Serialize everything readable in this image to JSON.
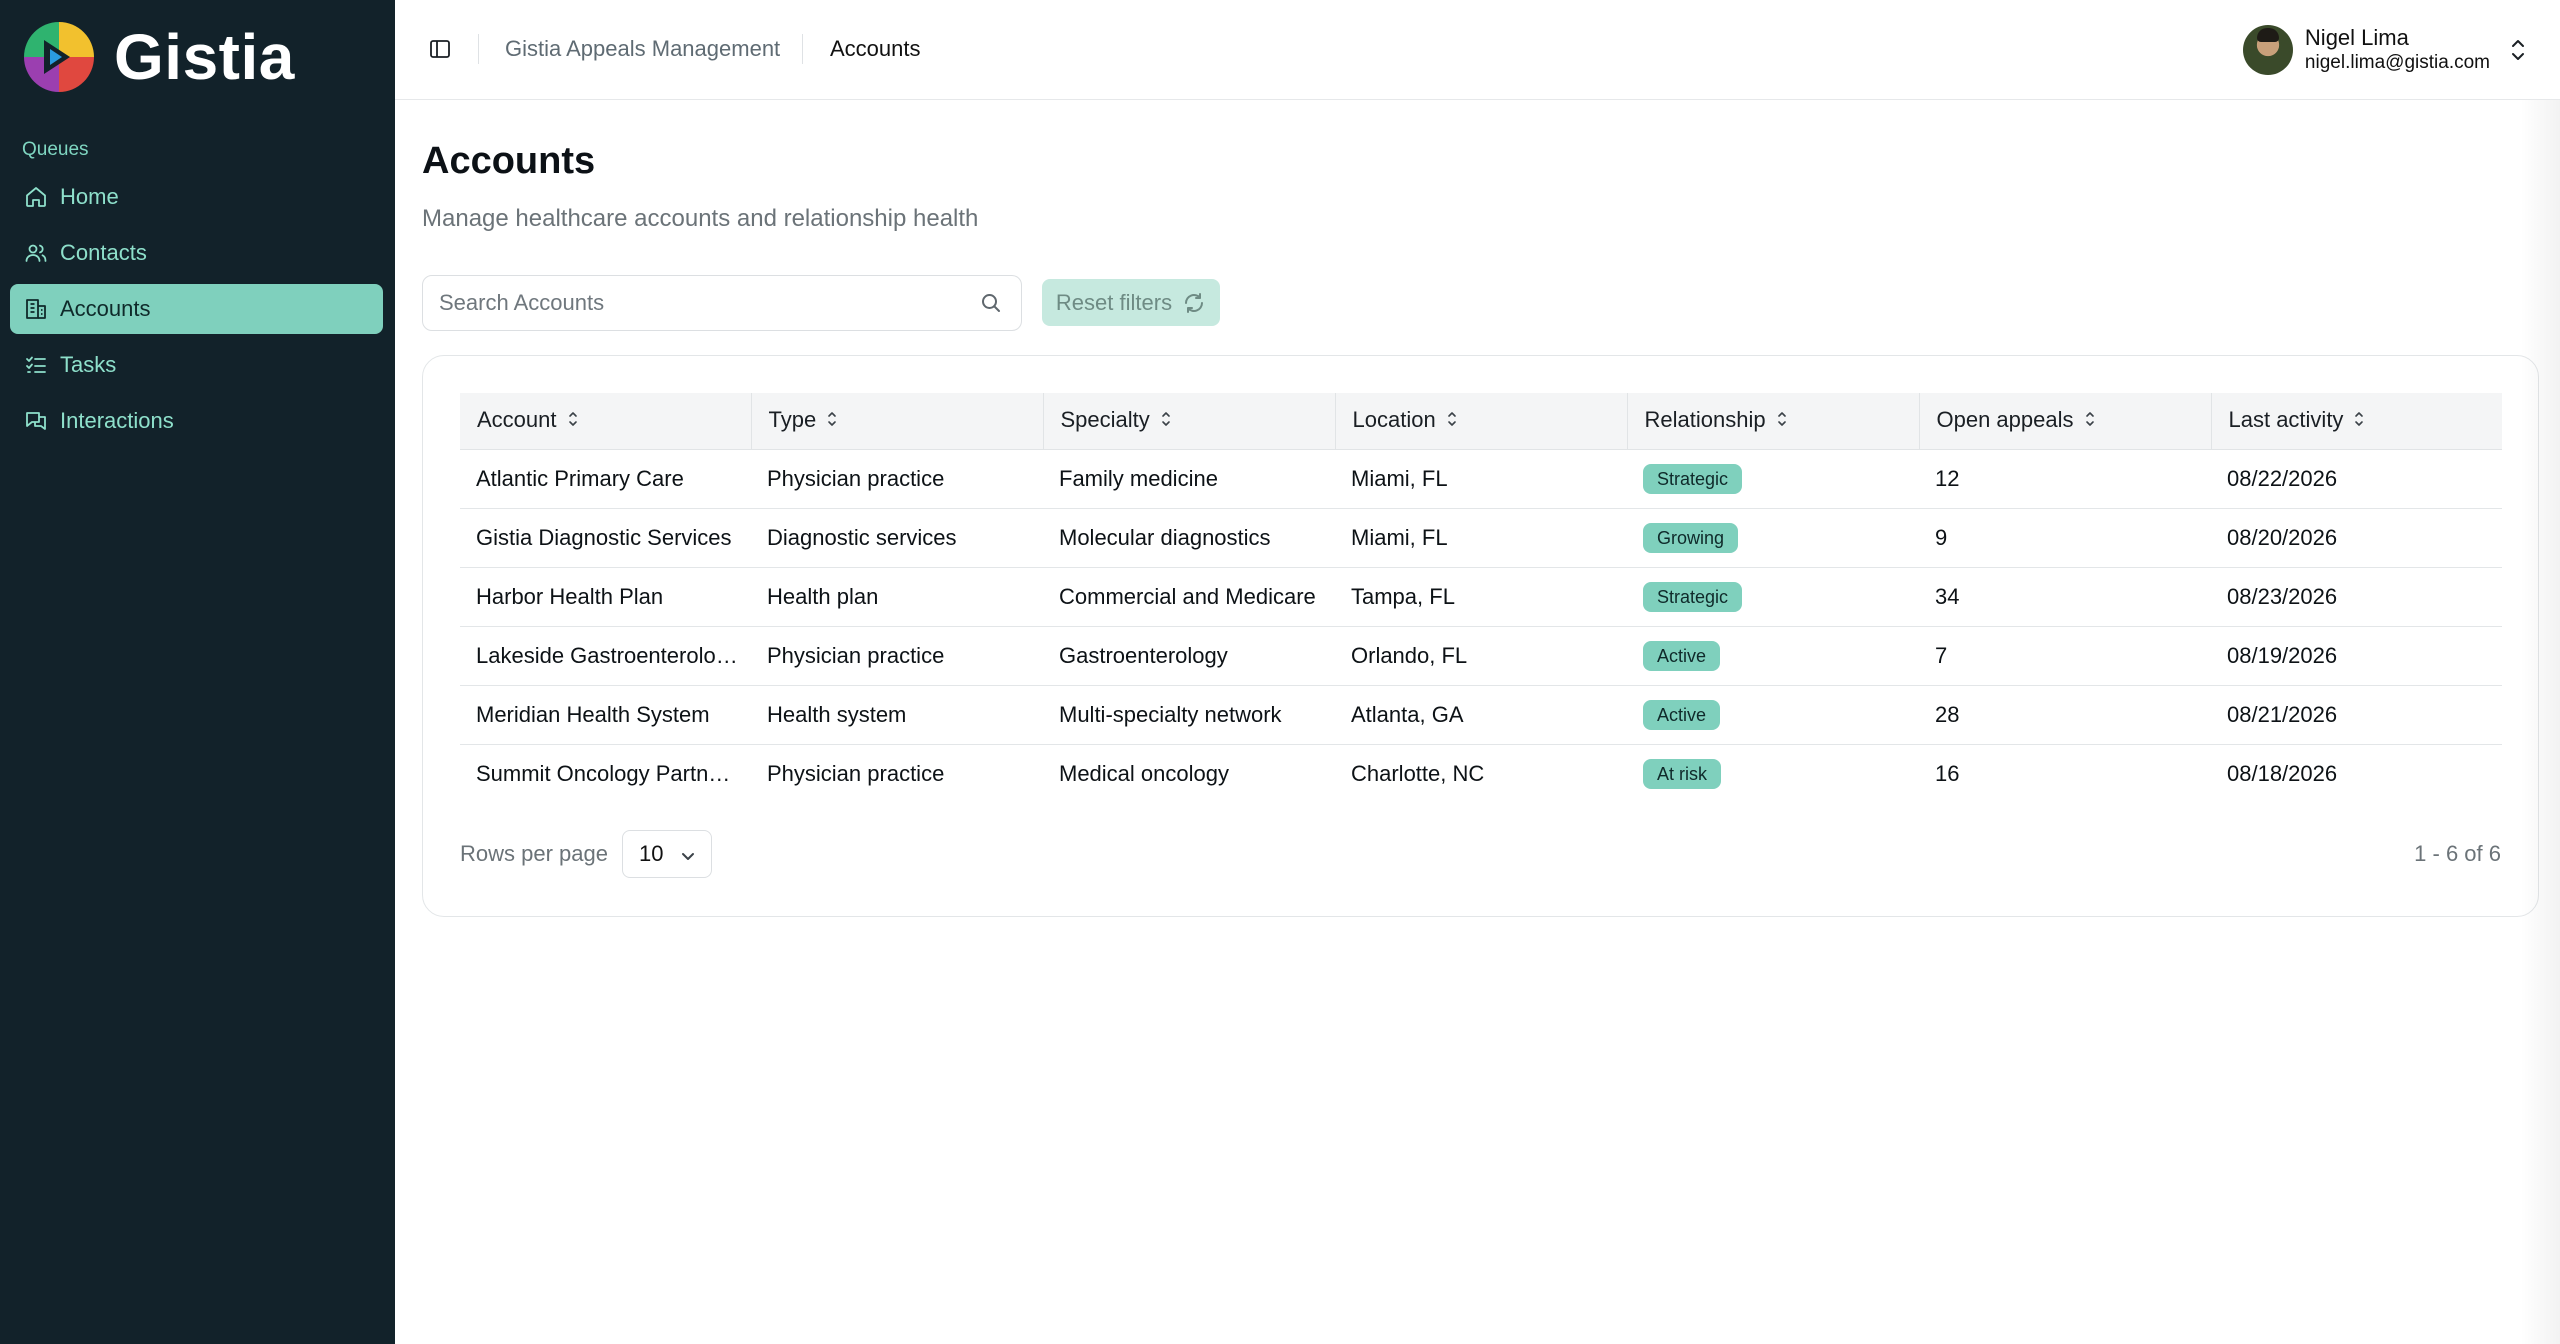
{
  "app": {
    "name": "Gistia"
  },
  "sidebar": {
    "section_label": "Queues",
    "items": [
      {
        "label": "Home",
        "icon": "home-icon"
      },
      {
        "label": "Contacts",
        "icon": "users-icon"
      },
      {
        "label": "Accounts",
        "icon": "building-icon",
        "active": true
      },
      {
        "label": "Tasks",
        "icon": "list-checks-icon"
      },
      {
        "label": "Interactions",
        "icon": "messages-icon"
      }
    ]
  },
  "header": {
    "breadcrumbs": [
      "Gistia Appeals Management",
      "Accounts"
    ],
    "user": {
      "name": "Nigel Lima",
      "email": "nigel.lima@gistia.com"
    }
  },
  "page": {
    "title": "Accounts",
    "subtitle": "Manage healthcare accounts and relationship health"
  },
  "search": {
    "placeholder": "Search Accounts",
    "value": ""
  },
  "reset_label": "Reset filters",
  "table": {
    "columns": [
      "Account",
      "Type",
      "Specialty",
      "Location",
      "Relationship",
      "Open appeals",
      "Last activity"
    ],
    "rows": [
      [
        "Atlantic Primary Care",
        "Physician practice",
        "Family medicine",
        "Miami, FL",
        "Strategic",
        "12",
        "08/22/2026"
      ],
      [
        "Gistia Diagnostic Services",
        "Diagnostic services",
        "Molecular diagnostics",
        "Miami, FL",
        "Growing",
        "9",
        "08/20/2026"
      ],
      [
        "Harbor Health Plan",
        "Health plan",
        "Commercial and Medicare",
        "Tampa, FL",
        "Strategic",
        "34",
        "08/23/2026"
      ],
      [
        "Lakeside Gastroenterolo…",
        "Physician practice",
        "Gastroenterology",
        "Orlando, FL",
        "Active",
        "7",
        "08/19/2026"
      ],
      [
        "Meridian Health System",
        "Health system",
        "Multi-specialty network",
        "Atlanta, GA",
        "Active",
        "28",
        "08/21/2026"
      ],
      [
        "Summit Oncology Partn…",
        "Physician practice",
        "Medical oncology",
        "Charlotte, NC",
        "At risk",
        "16",
        "08/18/2026"
      ]
    ]
  },
  "pagination": {
    "rows_per_page_label": "Rows per page",
    "rows_per_page": "10",
    "range": "1 - 6 of 6"
  },
  "colors": {
    "sidebar_bg": "#12222a",
    "accent": "#7fd0bd",
    "nav_text": "#8ee0cb"
  }
}
